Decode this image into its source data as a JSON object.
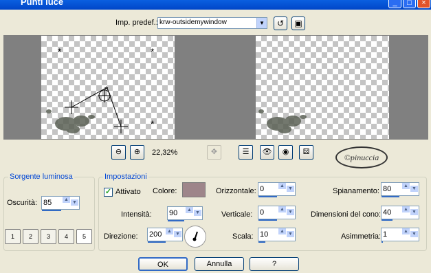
{
  "window": {
    "title": "Punti luce"
  },
  "preset": {
    "label": "Imp. predef.:",
    "value": "krw-outsidemywindow"
  },
  "zoom": {
    "value": "22,32%"
  },
  "watermark": "©pinuccia",
  "sorgente": {
    "title": "Sorgente luminosa",
    "oscurita_label": "Oscurità:",
    "oscurita_value": "85",
    "preset_buttons": [
      "1",
      "2",
      "3",
      "4",
      "5"
    ]
  },
  "impostazioni": {
    "title": "Impostazioni",
    "attivato_label": "Attivato",
    "attivato_checked": true,
    "colore_label": "Colore:",
    "colore_value": "#9e858a",
    "intensita_label": "Intensità:",
    "intensita_value": "90",
    "direzione_label": "Direzione:",
    "direzione_value": "200",
    "orizzontale_label": "Orizzontale:",
    "orizzontale_value": "0",
    "verticale_label": "Verticale:",
    "verticale_value": "0",
    "scala_label": "Scala:",
    "scala_value": "10",
    "spianamento_label": "Spianamento:",
    "spianamento_value": "80",
    "cono_label": "Dimensioni del cono:",
    "cono_value": "40",
    "asimmetria_label": "Asimmetria:",
    "asimmetria_value": "1"
  },
  "buttons": {
    "ok": "OK",
    "annulla": "Annulla",
    "help": "?"
  },
  "colors": {
    "title_bar": "#0a5fe0",
    "group_title": "#0046d5"
  }
}
